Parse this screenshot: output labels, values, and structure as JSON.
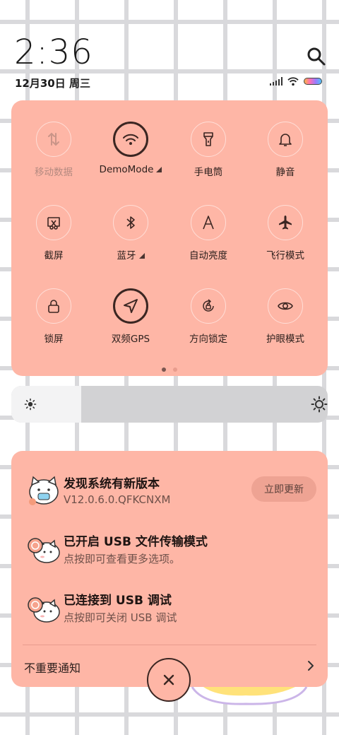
{
  "status_bar": {
    "time": "2:36",
    "date": "12月30日 周三"
  },
  "quick_settings": {
    "tiles": [
      {
        "label": "移动数据",
        "icon": "mobile-data-icon",
        "active": false,
        "disabled": true,
        "dropdown": false
      },
      {
        "label": "DemoMode",
        "icon": "wifi-icon",
        "active": true,
        "disabled": false,
        "dropdown": true
      },
      {
        "label": "手电筒",
        "icon": "flashlight-icon",
        "active": false,
        "disabled": false,
        "dropdown": false
      },
      {
        "label": "静音",
        "icon": "bell-icon",
        "active": false,
        "disabled": false,
        "dropdown": false
      },
      {
        "label": "截屏",
        "icon": "screenshot-icon",
        "active": false,
        "disabled": false,
        "dropdown": false
      },
      {
        "label": "蓝牙",
        "icon": "bluetooth-icon",
        "active": false,
        "disabled": false,
        "dropdown": true
      },
      {
        "label": "自动亮度",
        "icon": "auto-brightness-icon",
        "active": false,
        "disabled": false,
        "dropdown": false
      },
      {
        "label": "飞行模式",
        "icon": "airplane-icon",
        "active": false,
        "disabled": false,
        "dropdown": false
      },
      {
        "label": "锁屏",
        "icon": "lock-icon",
        "active": false,
        "disabled": false,
        "dropdown": false
      },
      {
        "label": "双频GPS",
        "icon": "location-arrow-icon",
        "active": true,
        "disabled": false,
        "dropdown": false
      },
      {
        "label": "方向锁定",
        "icon": "rotation-lock-icon",
        "active": false,
        "disabled": false,
        "dropdown": false
      },
      {
        "label": "护眼模式",
        "icon": "eye-icon",
        "active": false,
        "disabled": false,
        "dropdown": false
      }
    ],
    "page_count": 2,
    "current_page": 1
  },
  "brightness": {
    "level": 0.22
  },
  "notifications": [
    {
      "title": "发现系统有新版本",
      "subtitle": "V12.0.6.0.QFKCNXM",
      "action": "立即更新",
      "avatar": "cat-mask-avatar-icon"
    },
    {
      "title": "已开启 USB 文件传输模式",
      "subtitle": "点按即可查看更多选项。",
      "avatar": "cat-tray-avatar-icon"
    },
    {
      "title": "已连接到 USB 调试",
      "subtitle": "点按即可关闭 USB 调试",
      "avatar": "cat-tray-avatar-icon"
    }
  ],
  "footer": {
    "unimportant_label": "不重要通知"
  },
  "colors": {
    "panel": "#feb6a6",
    "accent_dark": "#3b2622"
  }
}
